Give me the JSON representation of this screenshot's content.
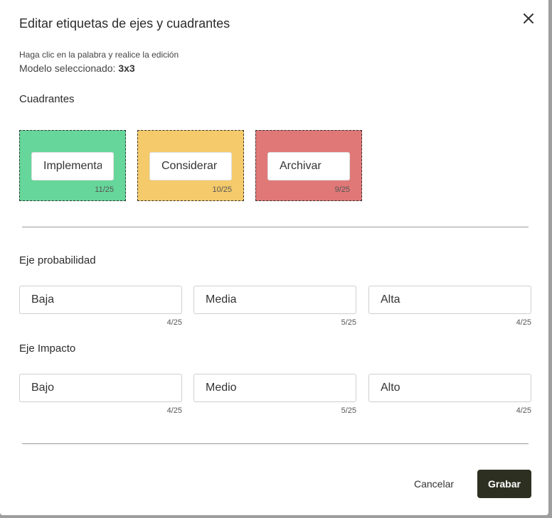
{
  "dialog": {
    "title": "Editar etiquetas de ejes y cuadrantes",
    "hint": "Haga clic en la palabra y realice la edición",
    "model_label": "Modelo seleccionado: ",
    "model_value": "3x3",
    "close_icon": "close-icon"
  },
  "quadrants": {
    "title": "Cuadrantes",
    "items": [
      {
        "value": "Implementar",
        "count": "11/25",
        "color": "#66d69a"
      },
      {
        "value": "Considerar",
        "count": "10/25",
        "color": "#f4ca6b"
      },
      {
        "value": "Archivar",
        "count": "9/25",
        "color": "#e07878"
      }
    ]
  },
  "probability_axis": {
    "title": "Eje probabilidad",
    "fields": [
      {
        "value": "Baja",
        "count": "4/25"
      },
      {
        "value": "Media",
        "count": "5/25"
      },
      {
        "value": "Alta",
        "count": "4/25"
      }
    ]
  },
  "impact_axis": {
    "title": "Eje Impacto",
    "fields": [
      {
        "value": "Bajo",
        "count": "4/25"
      },
      {
        "value": "Medio",
        "count": "5/25"
      },
      {
        "value": "Alto",
        "count": "4/25"
      }
    ]
  },
  "actions": {
    "cancel_label": "Cancelar",
    "save_label": "Grabar",
    "save_color": "#2d3020"
  }
}
